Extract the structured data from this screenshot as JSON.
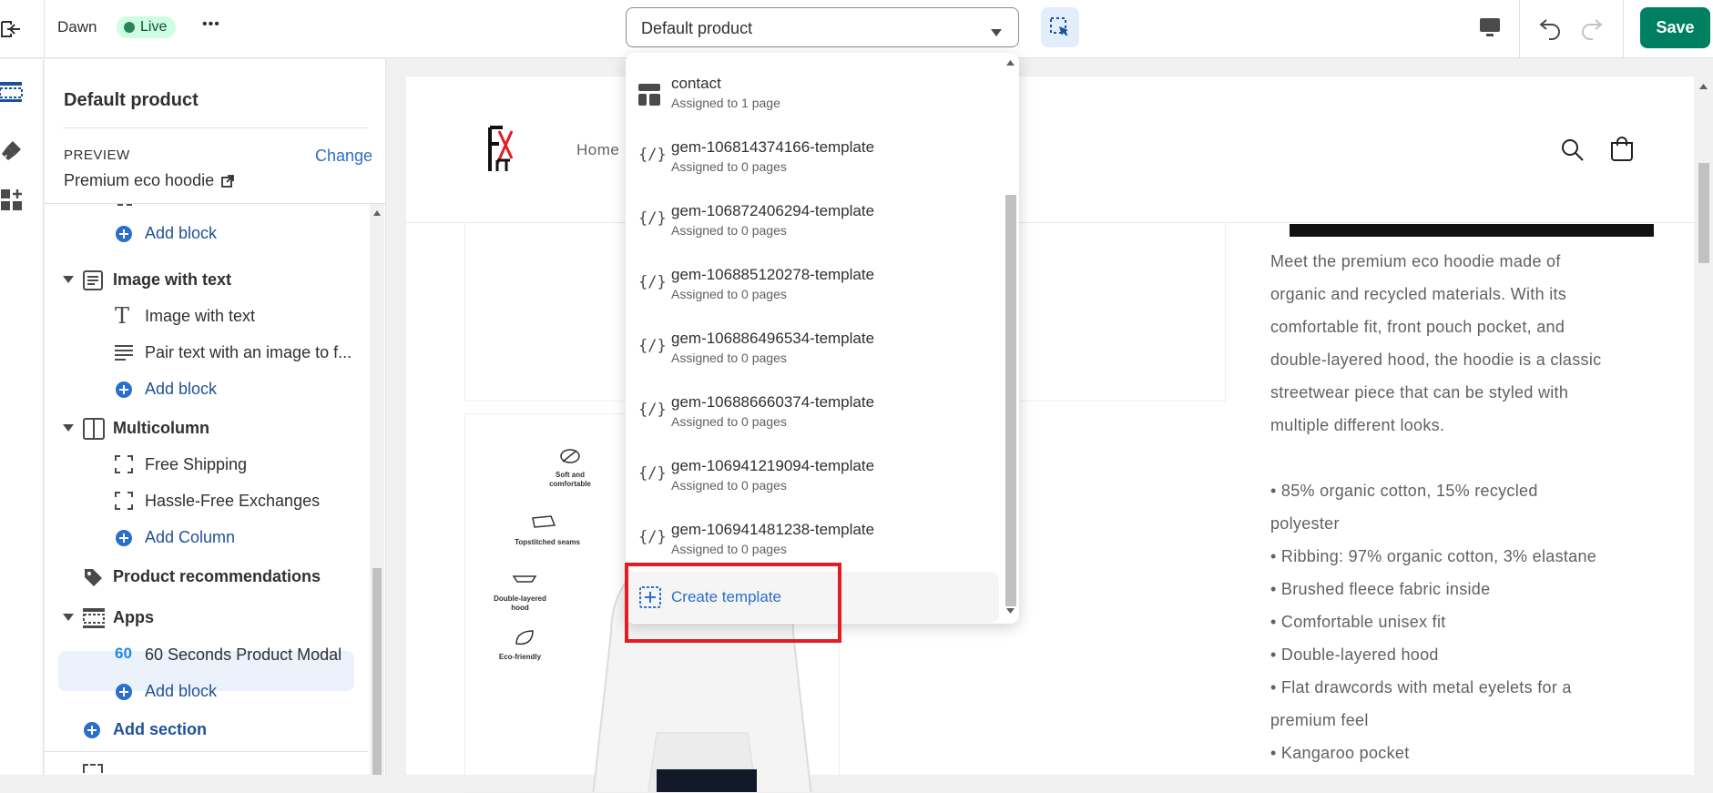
{
  "topbar": {
    "theme_name": "Dawn",
    "live_badge": "Live",
    "more_label": "•••",
    "template_select_value": "Default product",
    "save_label": "Save"
  },
  "sidebar": {
    "title": "Default product",
    "preview_label": "PREVIEW",
    "change_label": "Change",
    "preview_product": "Premium eco hoodie",
    "tree": {
      "add_block_1": "Add block",
      "image_with_text": "Image with text",
      "image_with_text_block": "Image with text",
      "pair_text_block": "Pair text with an image to f...",
      "add_block_2": "Add block",
      "multicolumn": "Multicolumn",
      "free_shipping": "Free Shipping",
      "hassle_free": "Hassle-Free Exchanges",
      "add_column": "Add Column",
      "product_recommendations": "Product recommendations",
      "apps": "Apps",
      "app_block": "60 Seconds Product Modal",
      "add_block_3": "Add block",
      "add_section": "Add section"
    }
  },
  "dropdown": {
    "items": [
      {
        "title": "contact",
        "sub": "Assigned to 1 page"
      },
      {
        "title": "gem-106814374166-template",
        "sub": "Assigned to 0 pages"
      },
      {
        "title": "gem-106872406294-template",
        "sub": "Assigned to 0 pages"
      },
      {
        "title": "gem-106885120278-template",
        "sub": "Assigned to 0 pages"
      },
      {
        "title": "gem-106886496534-template",
        "sub": "Assigned to 0 pages"
      },
      {
        "title": "gem-106886660374-template",
        "sub": "Assigned to 0 pages"
      },
      {
        "title": "gem-106941219094-template",
        "sub": "Assigned to 0 pages"
      },
      {
        "title": "gem-106941481238-template",
        "sub": "Assigned to 0 pages"
      }
    ],
    "create_label": "Create template"
  },
  "store": {
    "nav_home": "Home",
    "feature_labels": [
      "Soft and comfortable",
      "Topstitched seams",
      "Double-layered hood",
      "Eco-friendly"
    ],
    "description": [
      "Meet the premium eco hoodie made of",
      "organic and recycled materials. With its",
      "comfortable fit, front pouch pocket, and",
      "double-layered hood, the hoodie is a classic",
      "streetwear piece that can be styled with",
      "multiple different looks."
    ],
    "bullets": [
      "• 85% organic cotton, 15% recycled",
      "polyester",
      "• Ribbing: 97% organic cotton, 3% elastane",
      "• Brushed fleece fabric inside",
      "• Comfortable unisex fit",
      "• Double-layered hood",
      "• Flat drawcords with metal eyelets for a",
      "premium feel",
      "• Kangaroo pocket"
    ]
  },
  "colors": {
    "accent_blue": "#2c6ecb",
    "save_green": "#008060",
    "highlight_red": "#e51c23"
  }
}
